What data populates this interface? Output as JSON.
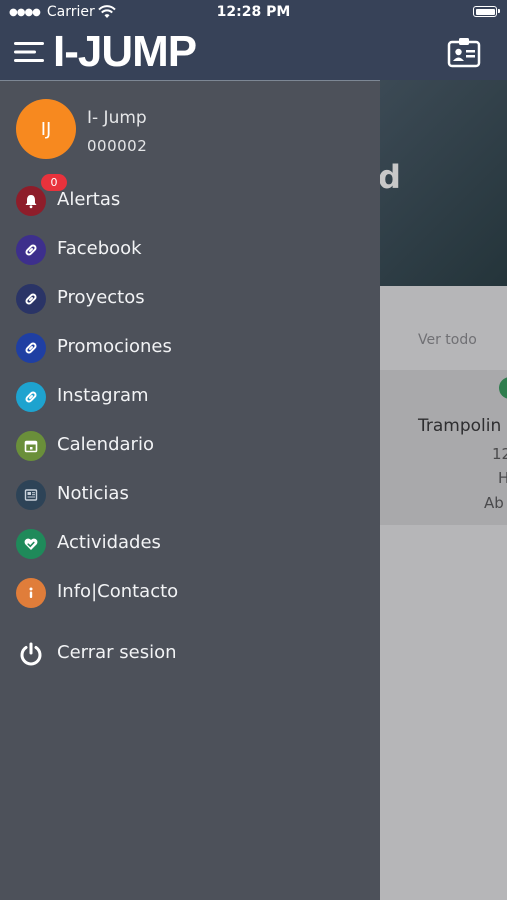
{
  "status_bar": {
    "carrier": "Carrier",
    "time": "12:28 PM"
  },
  "header": {
    "logo_text": "I-JUMP",
    "menu_icon": "hamburger-icon",
    "card_icon": "id-card-icon"
  },
  "background": {
    "hero_fragment": "d",
    "see_all": "Ver todo",
    "card_title": "Trampolin",
    "card_line1": "12",
    "card_line2": "H",
    "card_line3": "Ab"
  },
  "profile": {
    "initials": "IJ",
    "name": "I- Jump",
    "id": "000002",
    "avatar_color": "#f7891f"
  },
  "menu": {
    "items": [
      {
        "label": "Alertas",
        "icon": "bell-icon",
        "color": "#8e1d2a",
        "badge": "0"
      },
      {
        "label": "Facebook",
        "icon": "link-icon",
        "color": "#3d2f8c"
      },
      {
        "label": "Proyectos",
        "icon": "link-icon",
        "color": "#2a3466"
      },
      {
        "label": "Promociones",
        "icon": "link-icon",
        "color": "#1f3fa3"
      },
      {
        "label": "Instagram",
        "icon": "link-icon",
        "color": "#1ea3cf"
      },
      {
        "label": "Calendario",
        "icon": "calendar-icon",
        "color": "#6a8f3a"
      },
      {
        "label": "Noticias",
        "icon": "newspaper-icon",
        "color": "#2d4357"
      },
      {
        "label": "Actividades",
        "icon": "heart-icon",
        "color": "#1f8a5a"
      },
      {
        "label": "Info|Contacto",
        "icon": "info-icon",
        "color": "#e07d3a"
      }
    ],
    "logout": {
      "label": "Cerrar sesion",
      "icon": "power-icon"
    }
  }
}
